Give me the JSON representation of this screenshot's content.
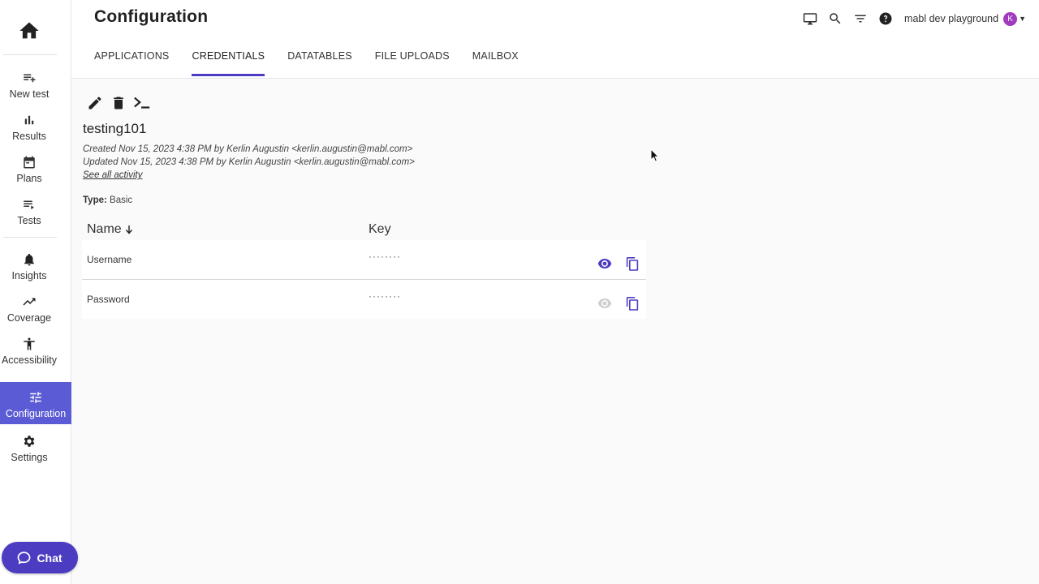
{
  "sidebar": {
    "home_icon": "home-icon",
    "items": [
      {
        "label": "New test",
        "icon": "playlist-add-icon"
      },
      {
        "label": "Results",
        "icon": "bar-chart-icon"
      },
      {
        "label": "Plans",
        "icon": "calendar-icon"
      },
      {
        "label": "Tests",
        "icon": "list-icon"
      },
      {
        "label": "Insights",
        "icon": "bell-icon"
      },
      {
        "label": "Coverage",
        "icon": "trend-icon"
      },
      {
        "label": "Accessibility",
        "icon": "accessibility-icon"
      },
      {
        "label": "Configuration",
        "icon": "tune-icon",
        "active": true
      },
      {
        "label": "Settings",
        "icon": "gear-icon"
      }
    ],
    "chat_label": "Chat"
  },
  "header": {
    "title": "Configuration",
    "tabs": [
      "APPLICATIONS",
      "CREDENTIALS",
      "DATATABLES",
      "FILE UPLOADS",
      "MAILBOX"
    ],
    "active_tab": "CREDENTIALS",
    "workspace": "mabl dev playground",
    "avatar_letter": "K"
  },
  "credential": {
    "name": "testing101",
    "created": "Created Nov 15, 2023 4:38 PM by Kerlin Augustin <kerlin.augustin@mabl.com>",
    "updated": "Updated Nov 15, 2023 4:38 PM by Kerlin Augustin <kerlin.augustin@mabl.com>",
    "see_all": "See all activity",
    "type_label": "Type:",
    "type_value": "Basic"
  },
  "table": {
    "col_name": "Name",
    "col_key": "Key",
    "rows": [
      {
        "name": "Username",
        "value": "········"
      },
      {
        "name": "Password",
        "value": "········"
      }
    ]
  },
  "colors": {
    "accent": "#4c3cc2",
    "active_nav": "#5b5bd6",
    "avatar": "#a13bbf"
  }
}
